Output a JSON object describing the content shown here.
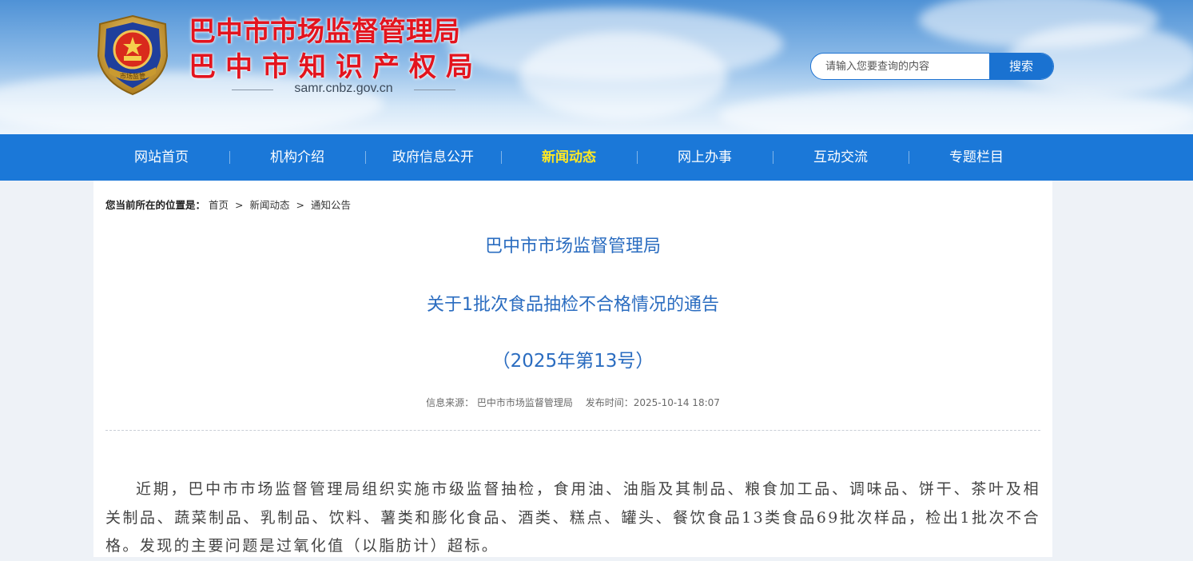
{
  "header": {
    "title_line1": "巴中市市场监督管理局",
    "title_line2": "巴中市知识产权局",
    "domain": "samr.cnbz.gov.cn",
    "emblem_text": "市场监管",
    "search_placeholder": "请输入您要查询的内容",
    "search_button": "搜索"
  },
  "nav": {
    "items": [
      {
        "label": "网站首页"
      },
      {
        "label": "机构介绍"
      },
      {
        "label": "政府信息公开"
      },
      {
        "label": "新闻动态"
      },
      {
        "label": "网上办事"
      },
      {
        "label": "互动交流"
      },
      {
        "label": "专题栏目"
      }
    ],
    "active_color": "#ffe823"
  },
  "breadcrumb": {
    "prefix": "您当前所在的位置是：",
    "items": [
      "首页",
      "新闻动态",
      "通知公告"
    ],
    "separator": ">"
  },
  "article": {
    "title_line1": "巴中市市场监督管理局",
    "title_line2": "关于1批次食品抽检不合格情况的通告",
    "title_line3": "（2025年第13号）",
    "source": "信息来源： 巴中市市场监督管理局",
    "published": "发布时间：2025-10-14 18:07",
    "body": "近期，巴中市市场监督管理局组织实施市级监督抽检，食用油、油脂及其制品、粮食加工品、调味品、饼干、茶叶及相关制品、蔬菜制品、乳制品、饮料、薯类和膨化食品、酒类、糕点、罐头、餐饮食品13类食品69批次样品，检出1批次不合格。发现的主要问题是过氧化值（以脂肪计）超标。"
  },
  "colors": {
    "title_red": "#e3141e",
    "nav_blue": "#1b78d8",
    "headline_blue": "#2a6cc0"
  }
}
